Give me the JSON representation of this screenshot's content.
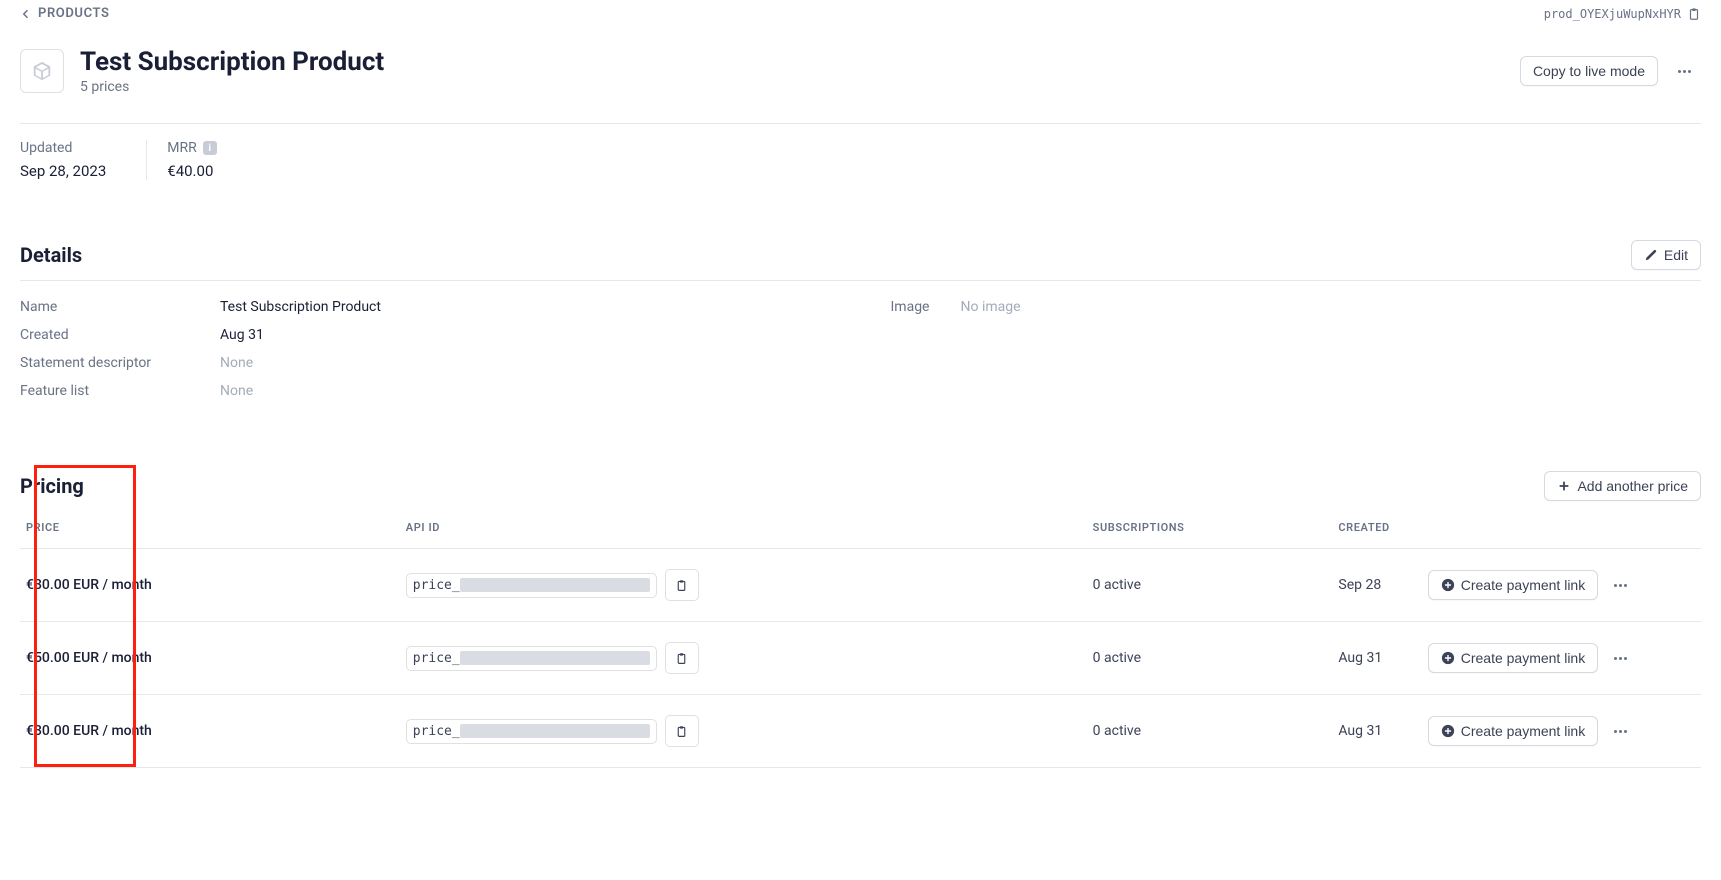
{
  "breadcrumb": {
    "label": "PRODUCTS"
  },
  "product_id": "prod_OYEXjuWupNxHYR",
  "header": {
    "title": "Test Subscription Product",
    "subtitle": "5 prices",
    "copy_button": "Copy to live mode"
  },
  "stats": {
    "updated_label": "Updated",
    "updated_value": "Sep 28, 2023",
    "mrr_label": "MRR",
    "mrr_value": "€40.00"
  },
  "details": {
    "heading": "Details",
    "edit_label": "Edit",
    "rows": {
      "name_label": "Name",
      "name_value": "Test Subscription Product",
      "created_label": "Created",
      "created_value": "Aug 31",
      "stmt_label": "Statement descriptor",
      "stmt_value": "None",
      "feat_label": "Feature list",
      "feat_value": "None",
      "image_label": "Image",
      "image_value": "No image"
    }
  },
  "pricing": {
    "heading": "Pricing",
    "add_button": "Add another price",
    "columns": {
      "price": "PRICE",
      "api_id": "API ID",
      "subs": "SUBSCRIPTIONS",
      "created": "CREATED"
    },
    "rows": [
      {
        "price": "€30.00 EUR / month",
        "api_prefix": "price_",
        "subs": "0 active",
        "created": "Sep 28",
        "link_label": "Create payment link"
      },
      {
        "price": "€50.00 EUR / month",
        "api_prefix": "price_",
        "subs": "0 active",
        "created": "Aug 31",
        "link_label": "Create payment link"
      },
      {
        "price": "€30.00 EUR / month",
        "api_prefix": "price_",
        "subs": "0 active",
        "created": "Aug 31",
        "link_label": "Create payment link"
      }
    ]
  }
}
